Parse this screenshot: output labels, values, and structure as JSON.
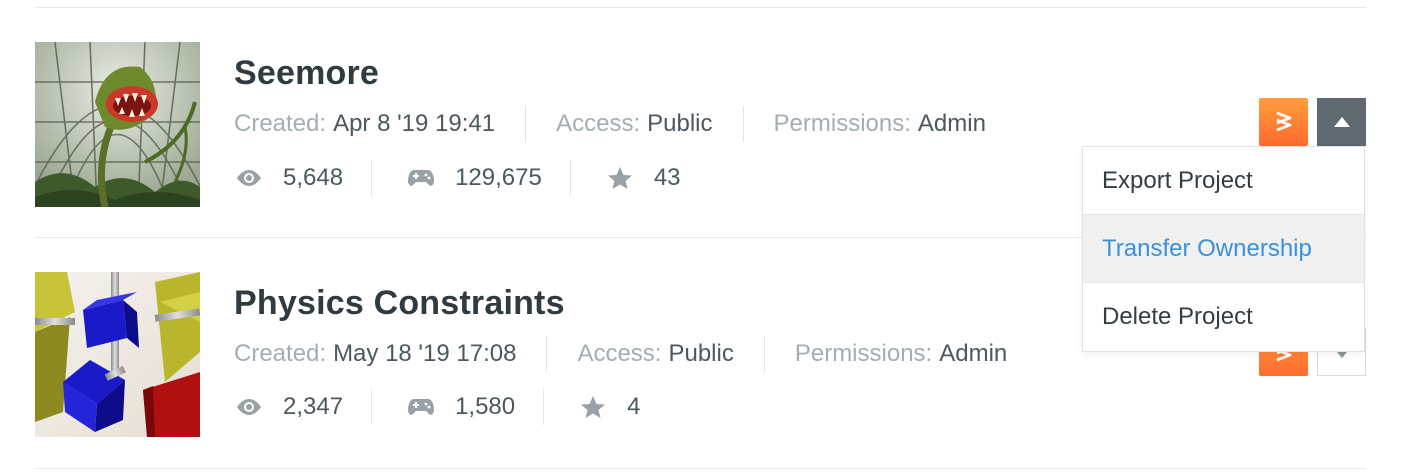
{
  "projects": [
    {
      "title": "Seemore",
      "created_label": "Created:",
      "created_value": "Apr 8 '19 19:41",
      "access_label": "Access:",
      "access_value": "Public",
      "permissions_label": "Permissions:",
      "permissions_value": "Admin",
      "views": "5,648",
      "plays": "129,675",
      "stars": "43"
    },
    {
      "title": "Physics Constraints",
      "created_label": "Created:",
      "created_value": "May 18 '19 17:08",
      "access_label": "Access:",
      "access_value": "Public",
      "permissions_label": "Permissions:",
      "permissions_value": "Admin",
      "views": "2,347",
      "plays": "1,580",
      "stars": "4"
    }
  ],
  "dropdown_menu": {
    "items": [
      "Export Project",
      "Transfer Ownership",
      "Delete Project"
    ],
    "highlighted_index": 1
  },
  "icons": {
    "views": "eye-icon",
    "plays": "gamepad-icon",
    "stars": "star-icon",
    "editor": "playcanvas-logo-icon",
    "menu_open": "caret-up-icon",
    "menu_closed": "caret-down-icon"
  },
  "colors": {
    "brand_orange": "#ff7a32",
    "link_blue": "#3b91d8",
    "toggle_active": "#5f6a70",
    "muted_text": "#a3adb2"
  }
}
